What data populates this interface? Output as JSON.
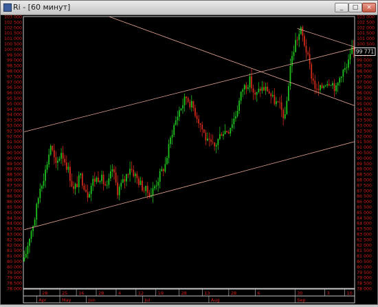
{
  "window": {
    "title": "Ri - [60 минут]",
    "buttons": {
      "minimize": "_",
      "maximize": "□",
      "close": "×"
    }
  },
  "colors": {
    "background": "#000000",
    "axis_text": "#d8201a",
    "grid_frame": "#c8c8c8",
    "bull_candle": "#1ec21e",
    "bear_candle": "#d02a1a",
    "trend_lines": "#e8a898",
    "last_price_box": "#e8e8e8"
  },
  "chart_data": {
    "type": "candlestick",
    "timeframe": "60 минут",
    "ylim": [
      78000,
      103000
    ],
    "y_tick_labels": [
      "103 000",
      "102 500",
      "102 000",
      "101 500",
      "101 000",
      "100 500",
      "100 000",
      "99 500",
      "99 000",
      "98 500",
      "98 000",
      "97 500",
      "97 000",
      "96 500",
      "96 000",
      "95 500",
      "95 000",
      "94 500",
      "94 000",
      "93 500",
      "93 000",
      "92 500",
      "92 000",
      "91 500",
      "91 000",
      "90 500",
      "90 000",
      "89 500",
      "89 000",
      "88 500",
      "88 000",
      "87 500",
      "87 000",
      "86 500",
      "86 000",
      "85 500",
      "85 000",
      "84 500",
      "84 000",
      "83 500",
      "83 000",
      "82 500",
      "82 000",
      "81 500",
      "81 000",
      "80 500",
      "80 000",
      "79 500",
      "79 000",
      "78 500",
      "78 000"
    ],
    "last_price": "99 771",
    "x_day_labels": [
      "28",
      "25",
      "16",
      "28",
      "4",
      "12",
      "19",
      "28",
      "13",
      "28",
      "6",
      "30",
      "3",
      "10"
    ],
    "x_month_labels": [
      "Apr",
      "May",
      "Jun",
      "Jul",
      "Aug",
      "Sep"
    ],
    "price_path": [
      [
        0,
        80500
      ],
      [
        3,
        82800
      ],
      [
        6,
        84500
      ],
      [
        9,
        87300
      ],
      [
        12,
        88800
      ],
      [
        15,
        91200
      ],
      [
        18,
        89200
      ],
      [
        21,
        90600
      ],
      [
        25,
        88900
      ],
      [
        28,
        87000
      ],
      [
        32,
        88300
      ],
      [
        36,
        86700
      ],
      [
        39,
        87900
      ],
      [
        43,
        88300
      ],
      [
        47,
        87200
      ],
      [
        50,
        89000
      ],
      [
        53,
        87000
      ],
      [
        57,
        88000
      ],
      [
        60,
        89200
      ],
      [
        64,
        88100
      ],
      [
        68,
        87100
      ],
      [
        72,
        86700
      ],
      [
        76,
        88100
      ],
      [
        80,
        89400
      ],
      [
        84,
        92500
      ],
      [
        88,
        94400
      ],
      [
        92,
        95600
      ],
      [
        96,
        94600
      ],
      [
        100,
        93100
      ],
      [
        104,
        91400
      ],
      [
        108,
        91000
      ],
      [
        112,
        92400
      ],
      [
        116,
        92600
      ],
      [
        120,
        94000
      ],
      [
        124,
        96400
      ],
      [
        128,
        97100
      ],
      [
        131,
        95600
      ],
      [
        134,
        96400
      ],
      [
        138,
        96300
      ],
      [
        141,
        95400
      ],
      [
        145,
        94700
      ],
      [
        148,
        93600
      ],
      [
        151,
        98500
      ],
      [
        154,
        100700
      ],
      [
        157,
        101700
      ],
      [
        160,
        99900
      ],
      [
        163,
        97600
      ],
      [
        166,
        96100
      ],
      [
        168,
        96300
      ],
      [
        171,
        97000
      ],
      [
        174,
        97100
      ],
      [
        177,
        96300
      ],
      [
        180,
        97900
      ],
      [
        183,
        98200
      ],
      [
        186,
        99800
      ]
    ],
    "trend_lines": [
      {
        "name": "",
        "from": [
          0,
          92400
        ],
        "to": [
          188,
          100100
        ]
      },
      {
        "name": "",
        "from": [
          0,
          83400
        ],
        "to": [
          188,
          91500
        ]
      },
      {
        "name": "",
        "from": [
          48,
          103000
        ],
        "to": [
          188,
          94800
        ]
      },
      {
        "name": "",
        "from": [
          155,
          101900
        ],
        "to": [
          188,
          100200
        ]
      }
    ]
  }
}
